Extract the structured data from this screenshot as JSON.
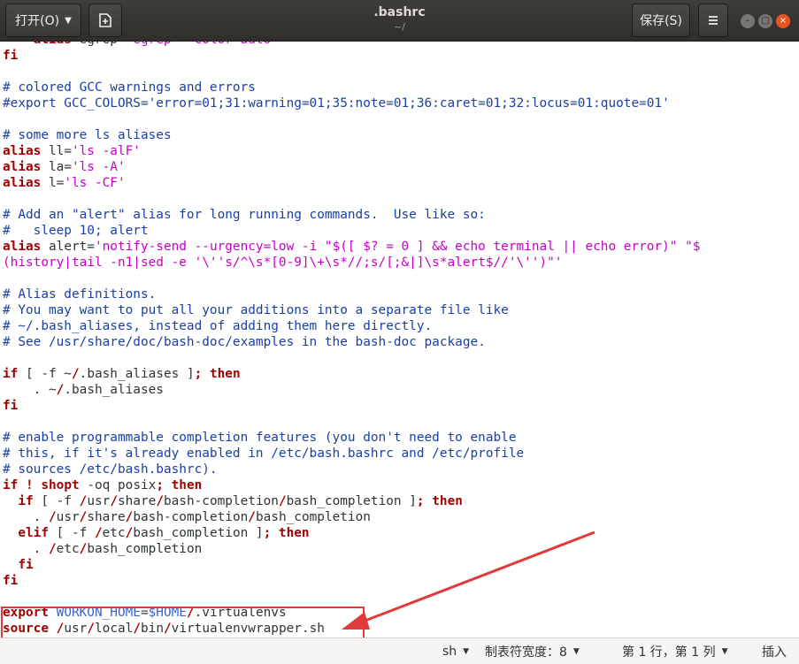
{
  "window": {
    "title": ".bashrc",
    "subtitle": "~/",
    "open_label": "打开(O)",
    "save_label": "保存(S)",
    "newdoc_icon": "new-document-icon",
    "menu_icon": "hamburger-menu-icon",
    "controls": {
      "minimize": "–",
      "maximize": "□",
      "close": "×"
    }
  },
  "editor": {
    "lines": [
      [
        [
          "k",
          "    alias"
        ],
        [
          "p",
          " egrep="
        ],
        [
          "s",
          "'egrep --color=auto'"
        ]
      ],
      [
        [
          "k",
          "fi"
        ]
      ],
      [],
      [
        [
          "c",
          "# colored GCC warnings and errors"
        ]
      ],
      [
        [
          "c",
          "#export GCC_COLORS='error=01;31:warning=01;35:note=01;36:caret=01;32:locus=01:quote=01'"
        ]
      ],
      [],
      [
        [
          "c",
          "# some more ls aliases"
        ]
      ],
      [
        [
          "k",
          "alias"
        ],
        [
          "p",
          " ll="
        ],
        [
          "s",
          "'ls -alF'"
        ]
      ],
      [
        [
          "k",
          "alias"
        ],
        [
          "p",
          " la="
        ],
        [
          "s",
          "'ls -A'"
        ]
      ],
      [
        [
          "k",
          "alias"
        ],
        [
          "p",
          " l="
        ],
        [
          "s",
          "'ls -CF'"
        ]
      ],
      [],
      [
        [
          "c",
          "# Add an \"alert\" alias for long running commands.  Use like so:"
        ]
      ],
      [
        [
          "c",
          "#   sleep 10; alert"
        ]
      ],
      [
        [
          "k",
          "alias"
        ],
        [
          "p",
          " alert="
        ],
        [
          "s",
          "'notify-send --urgency=low -i \"$([ $? = 0 ] && echo terminal || echo error)\" \"$"
        ]
      ],
      [
        [
          "s",
          "(history|tail -n1|sed -e '\\''s/^\\s*[0-9]\\+\\s*//;s/[;&|]\\s*alert$//'\\'')\"'"
        ]
      ],
      [],
      [
        [
          "c",
          "# Alias definitions."
        ]
      ],
      [
        [
          "c",
          "# You may want to put all your additions into a separate file like"
        ]
      ],
      [
        [
          "c",
          "# ~/.bash_aliases, instead of adding them here directly."
        ]
      ],
      [
        [
          "c",
          "# See /usr/share/doc/bash-doc/examples in the bash-doc package."
        ]
      ],
      [],
      [
        [
          "k",
          "if"
        ],
        [
          "p",
          " [ -f ~"
        ],
        [
          "k",
          "/"
        ],
        [
          "p",
          ".bash_aliases ]"
        ],
        [
          "k",
          "; then"
        ]
      ],
      [
        [
          "p",
          "    . ~"
        ],
        [
          "k",
          "/"
        ],
        [
          "p",
          ".bash_aliases"
        ]
      ],
      [
        [
          "k",
          "fi"
        ]
      ],
      [],
      [
        [
          "c",
          "# enable programmable completion features (you don't need to enable"
        ]
      ],
      [
        [
          "c",
          "# this, if it's already enabled in /etc/bash.bashrc and /etc/profile"
        ]
      ],
      [
        [
          "c",
          "# sources /etc/bash.bashrc)."
        ]
      ],
      [
        [
          "k",
          "if"
        ],
        [
          "p",
          " "
        ],
        [
          "k",
          "!"
        ],
        [
          "p",
          " "
        ],
        [
          "k",
          "shopt"
        ],
        [
          "p",
          " -oq posix"
        ],
        [
          "k",
          "; then"
        ]
      ],
      [
        [
          "p",
          "  "
        ],
        [
          "k",
          "if"
        ],
        [
          "p",
          " [ -f "
        ],
        [
          "k",
          "/"
        ],
        [
          "p",
          "usr"
        ],
        [
          "k",
          "/"
        ],
        [
          "p",
          "share"
        ],
        [
          "k",
          "/"
        ],
        [
          "p",
          "bash-completion"
        ],
        [
          "k",
          "/"
        ],
        [
          "p",
          "bash_completion ]"
        ],
        [
          "k",
          "; then"
        ]
      ],
      [
        [
          "p",
          "    . "
        ],
        [
          "k",
          "/"
        ],
        [
          "p",
          "usr"
        ],
        [
          "k",
          "/"
        ],
        [
          "p",
          "share"
        ],
        [
          "k",
          "/"
        ],
        [
          "p",
          "bash-completion"
        ],
        [
          "k",
          "/"
        ],
        [
          "p",
          "bash_completion"
        ]
      ],
      [
        [
          "p",
          "  "
        ],
        [
          "k",
          "elif"
        ],
        [
          "p",
          " [ -f "
        ],
        [
          "k",
          "/"
        ],
        [
          "p",
          "etc"
        ],
        [
          "k",
          "/"
        ],
        [
          "p",
          "bash_completion ]"
        ],
        [
          "k",
          "; then"
        ]
      ],
      [
        [
          "p",
          "    . "
        ],
        [
          "k",
          "/"
        ],
        [
          "p",
          "etc"
        ],
        [
          "k",
          "/"
        ],
        [
          "p",
          "bash_completion"
        ]
      ],
      [
        [
          "p",
          "  "
        ],
        [
          "k",
          "fi"
        ]
      ],
      [
        [
          "k",
          "fi"
        ]
      ],
      [],
      [
        [
          "k",
          "export"
        ],
        [
          "p",
          " "
        ],
        [
          "v",
          "WORKON_HOME"
        ],
        [
          "p",
          "="
        ],
        [
          "v",
          "$HOME"
        ],
        [
          "k",
          "/"
        ],
        [
          "p",
          ".virtualenvs"
        ]
      ],
      [
        [
          "k",
          "source"
        ],
        [
          "p",
          " "
        ],
        [
          "k",
          "/"
        ],
        [
          "p",
          "usr"
        ],
        [
          "k",
          "/"
        ],
        [
          "p",
          "local"
        ],
        [
          "k",
          "/"
        ],
        [
          "p",
          "bin"
        ],
        [
          "k",
          "/"
        ],
        [
          "p",
          "virtualenvwrapper.sh"
        ]
      ]
    ]
  },
  "statusbar": {
    "language": "sh",
    "tab_width": "制表符宽度：8",
    "position": "第 1 行，第 1 列",
    "mode": "插入"
  },
  "annotation": {
    "highlight_color": "#e03a3a"
  }
}
